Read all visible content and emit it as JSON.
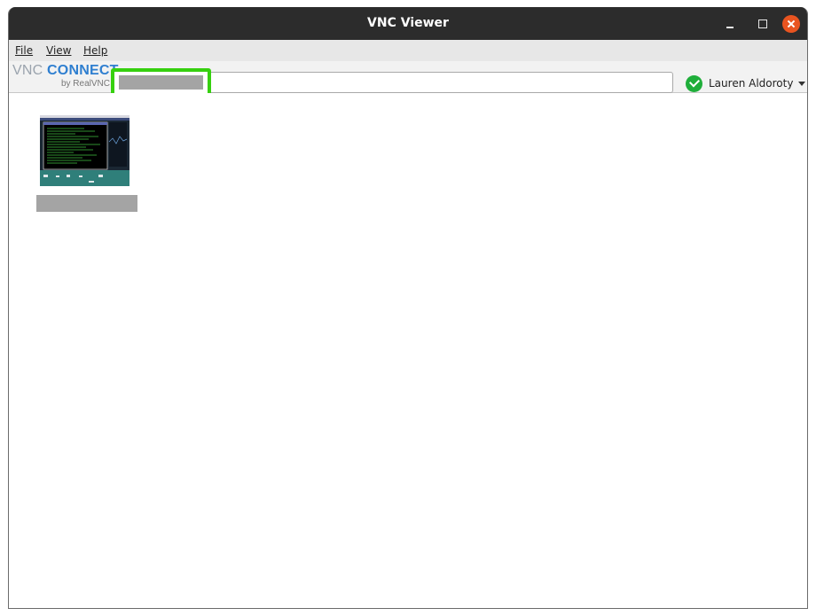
{
  "window": {
    "title": "VNC Viewer"
  },
  "menu": {
    "file": "File",
    "view": "View",
    "help": "Help"
  },
  "logo": {
    "vnc": "VNC",
    "connect": "CONNECT",
    "sub": "by RealVNC"
  },
  "search": {
    "value": "",
    "placeholder": ""
  },
  "account": {
    "name": "Lauren Aldoroty",
    "status": "signed-in",
    "status_icon": "check-circle-icon",
    "status_color": "#1fae3a"
  },
  "address_book": {
    "items": [
      {
        "name": "",
        "thumbnail": "remote-desktop-preview"
      }
    ]
  },
  "colors": {
    "focus_highlight": "#36d00f",
    "close_button": "#e95420",
    "titlebar": "#2c2c2c"
  }
}
